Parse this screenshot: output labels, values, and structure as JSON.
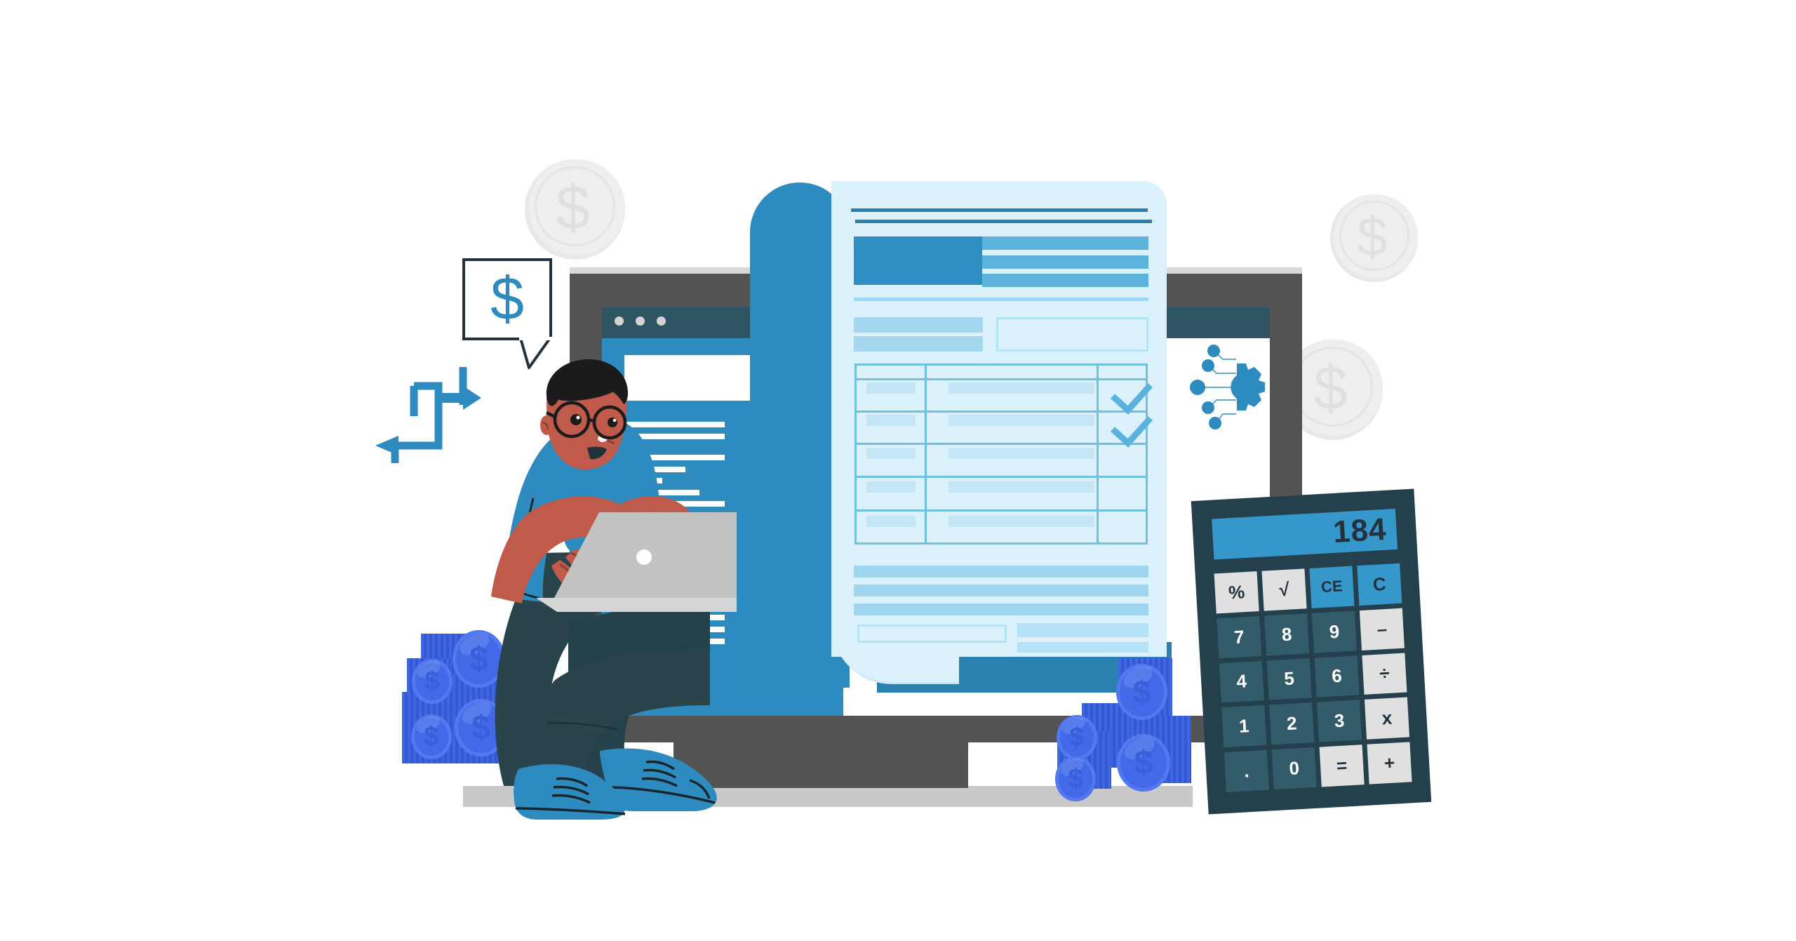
{
  "illustration": {
    "title": "Online invoice accounting illustration",
    "theme_colors": {
      "primary_blue": "#2d8bc0",
      "light_blue": "#5cb3dc",
      "pale_blue": "#dbf1fc",
      "dark_navy": "#24404d",
      "coin_blue": "#4169e8",
      "skin": "#c05a4b",
      "trousers": "#29444b",
      "gray_bezel": "#545454",
      "background": "#ffffff"
    }
  },
  "calculator": {
    "name": "desk-calculator",
    "display_value": "184",
    "keys": [
      {
        "label": "%",
        "style": "light"
      },
      {
        "label": "√",
        "style": "light"
      },
      {
        "label": "CE",
        "style": "blue"
      },
      {
        "label": "C",
        "style": "blue"
      },
      {
        "label": "7",
        "style": "dark"
      },
      {
        "label": "8",
        "style": "dark"
      },
      {
        "label": "9",
        "style": "dark"
      },
      {
        "label": "–",
        "style": "light"
      },
      {
        "label": "4",
        "style": "dark"
      },
      {
        "label": "5",
        "style": "dark"
      },
      {
        "label": "6",
        "style": "dark"
      },
      {
        "label": "÷",
        "style": "light"
      },
      {
        "label": "1",
        "style": "dark"
      },
      {
        "label": "2",
        "style": "dark"
      },
      {
        "label": "3",
        "style": "dark"
      },
      {
        "label": "x",
        "style": "light"
      },
      {
        "label": ".",
        "style": "dark"
      },
      {
        "label": "0",
        "style": "dark"
      },
      {
        "label": "=",
        "style": "light"
      },
      {
        "label": "+",
        "style": "light"
      }
    ]
  },
  "speech_bubble": {
    "name": "dollar-speech-bubble",
    "symbol": "$"
  },
  "ghost_coins": [
    {
      "name": "background-coin-left",
      "symbol": "$"
    },
    {
      "name": "background-coin-top-right",
      "symbol": "$"
    },
    {
      "name": "background-coin-right",
      "symbol": "$"
    }
  ],
  "coin_stacks": {
    "left": {
      "name": "coin-stack-left",
      "coin_symbol": "$",
      "coin_count": 4
    },
    "right": {
      "name": "coin-stack-right",
      "coin_symbol": "$",
      "coin_count": 4
    }
  },
  "browser_window": {
    "name": "monitor-browser-window",
    "titlebar_dots": 3,
    "sidebar_lines": 12,
    "avatar": "user-avatar"
  },
  "invoice_document": {
    "name": "invoice-paper",
    "header_rules": 2,
    "logo_block": "company-logo",
    "header_bars": 3,
    "fields": 2,
    "table": {
      "header_row": true,
      "rows": 5,
      "checked_rows": [
        1,
        2
      ],
      "check_symbol": "✓"
    },
    "footer_lines": 3,
    "signature_box": "signature-field",
    "total_bars": 2
  },
  "ai_gear": {
    "name": "ai-automation-gear",
    "nodes": 5
  }
}
